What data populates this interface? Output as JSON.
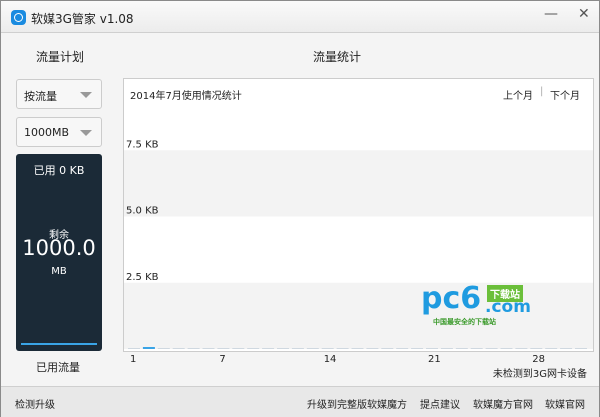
{
  "window": {
    "title": "软媒3G管家 v1.08",
    "minimize": "—",
    "close": "✕"
  },
  "left": {
    "heading": "流量计划",
    "mode_select": "按流量",
    "size_select": "1000MB",
    "used_label": "已用 0 KB",
    "remaining_label": "剩余",
    "remaining_value": "1000.0",
    "remaining_unit": "MB",
    "used_fraction": 0,
    "caption": "已用流量"
  },
  "main": {
    "heading": "流量统计",
    "chart_title": "2014年7月使用情况统计",
    "prev": "上个月",
    "sep": "|",
    "next": "下个月",
    "status": "未检测到3G网卡设备"
  },
  "watermark": {
    "logo": "pc6",
    "badge": "下载站",
    "domain": ".com",
    "slogan": "中国最安全的下载站"
  },
  "footer": {
    "check_update": "检测升级",
    "links": [
      "升级到完整版软媒魔方",
      "提点建议",
      "软媒魔方官网",
      "软媒官网"
    ]
  },
  "chart_data": {
    "type": "bar",
    "title": "2014年7月使用情况统计",
    "ylabel": "KB",
    "ylim": [
      0,
      10
    ],
    "yticks": [
      {
        "v": 7.5,
        "label": "7.5 KB"
      },
      {
        "v": 5.0,
        "label": "5.0 KB"
      },
      {
        "v": 2.5,
        "label": "2.5 KB"
      }
    ],
    "xticks": [
      {
        "v": 1,
        "label": "1"
      },
      {
        "v": 7,
        "label": "7"
      },
      {
        "v": 14,
        "label": "14"
      },
      {
        "v": 21,
        "label": "21"
      },
      {
        "v": 28,
        "label": "28"
      }
    ],
    "days": [
      1,
      2,
      3,
      4,
      5,
      6,
      7,
      8,
      9,
      10,
      11,
      12,
      13,
      14,
      15,
      16,
      17,
      18,
      19,
      20,
      21,
      22,
      23,
      24,
      25,
      26,
      27,
      28,
      29,
      30,
      31
    ],
    "values": [
      0,
      0.05,
      0,
      0,
      0,
      0,
      0,
      0,
      0,
      0,
      0,
      0,
      0,
      0,
      0,
      0,
      0,
      0,
      0,
      0,
      0,
      0,
      0,
      0,
      0,
      0,
      0,
      0,
      0,
      0,
      0
    ],
    "bar_color": "#3aa4e6",
    "zero_color": "#cfd8e0"
  }
}
